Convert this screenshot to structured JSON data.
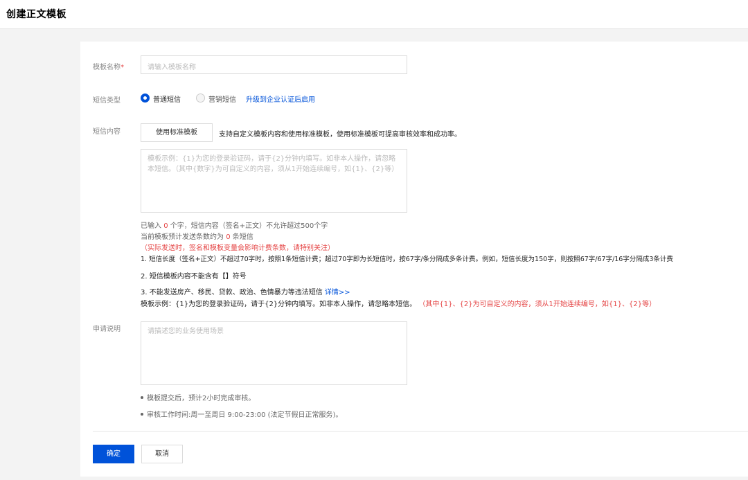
{
  "page": {
    "title": "创建正文模板"
  },
  "form": {
    "template_name": {
      "label": "模板名称",
      "required_mark": "*",
      "placeholder": "请输入模板名称"
    },
    "sms_type": {
      "label": "短信类型",
      "options": [
        {
          "label": "普通短信",
          "selected": true
        },
        {
          "label": "营销短信",
          "selected": false
        }
      ],
      "upgrade_link": "升级到企业认证后启用"
    },
    "sms_content": {
      "label": "短信内容",
      "standard_button": "使用标准模板",
      "hint": "支持自定义模板内容和使用标准模板，使用标准模板可提高审核效率和成功率。",
      "placeholder": "模板示例：{1}为您的登录验证码，请于{2}分钟内填写。如非本人操作，请忽略本短信。（其中{数字}为可自定义的内容，须从1开始连续编号，如{1}、{2}等）",
      "count_prefix": "已输入",
      "count_value": "0",
      "count_suffix": "个字，短信内容（签名+正文）不允许超过500个字",
      "estimate_prefix": "当前模板预计发送条数约为",
      "estimate_value": "0",
      "estimate_suffix": "条短信",
      "billing_note": "（实际发送时，签名和模板变量会影响计费条数，请特别关注）",
      "rules": [
        "1. 短信长度（签名+正文）不超过70字时，按照1条短信计费；超过70字即为长短信时，按67字/条分隔成多条计费。例如，短信长度为150字，则按照67字/67字/16字分隔成3条计费",
        "2. 短信模板内容不能含有【】符号",
        "3. 不能发送房产、移民、贷款、政治、色情暴力等违法短信"
      ],
      "details_link": "详情>>",
      "example_text": "模板示例：{1}为您的登录验证码，请于{2}分钟内填写。如非本人操作，请忽略本短信。",
      "example_note": "（其中{1}、{2}为可自定义的内容，须从1开始连续编号，如{1}、{2}等）"
    },
    "application": {
      "label": "申请说明",
      "placeholder": "请描述您的业务使用场景",
      "notes": [
        "模板提交后，预计2小时完成审核。",
        "审核工作时间:周一至周日 9:00-23:00 (法定节假日正常服务)。"
      ]
    }
  },
  "actions": {
    "confirm": "确定",
    "cancel": "取消"
  },
  "colors": {
    "primary": "#0052d9",
    "danger": "#e54545"
  }
}
